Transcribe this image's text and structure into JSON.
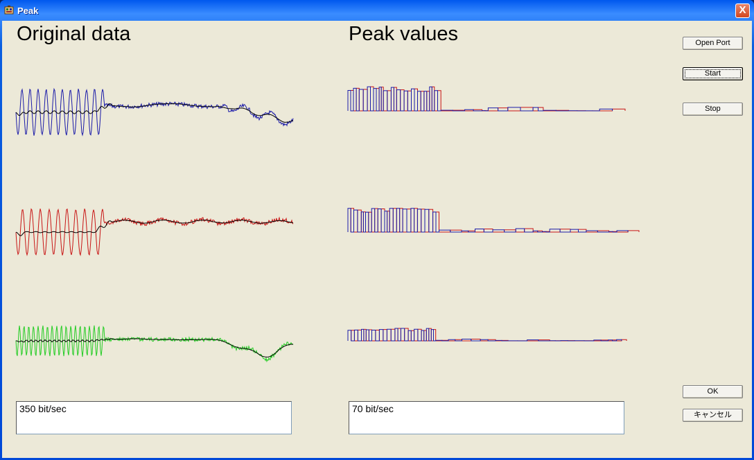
{
  "window": {
    "title": "Peak",
    "close_label": "X"
  },
  "headings": {
    "original": "Original data",
    "peak": "Peak values"
  },
  "buttons": {
    "open_port": "Open Port",
    "start": "Start",
    "stop": "Stop",
    "ok": "OK",
    "cancel": "キャンセル"
  },
  "rates": {
    "original": "350 bit/sec",
    "peak": "70 bit/sec"
  },
  "colors": {
    "channel1": "#1a1aa8",
    "channel2": "#c81414",
    "channel3": "#22cc22",
    "smooth": "#000000",
    "peak_high": "#1a1aa8",
    "peak_low": "#c81414"
  },
  "icons": {
    "app": "app-icon",
    "close": "close-icon"
  }
}
